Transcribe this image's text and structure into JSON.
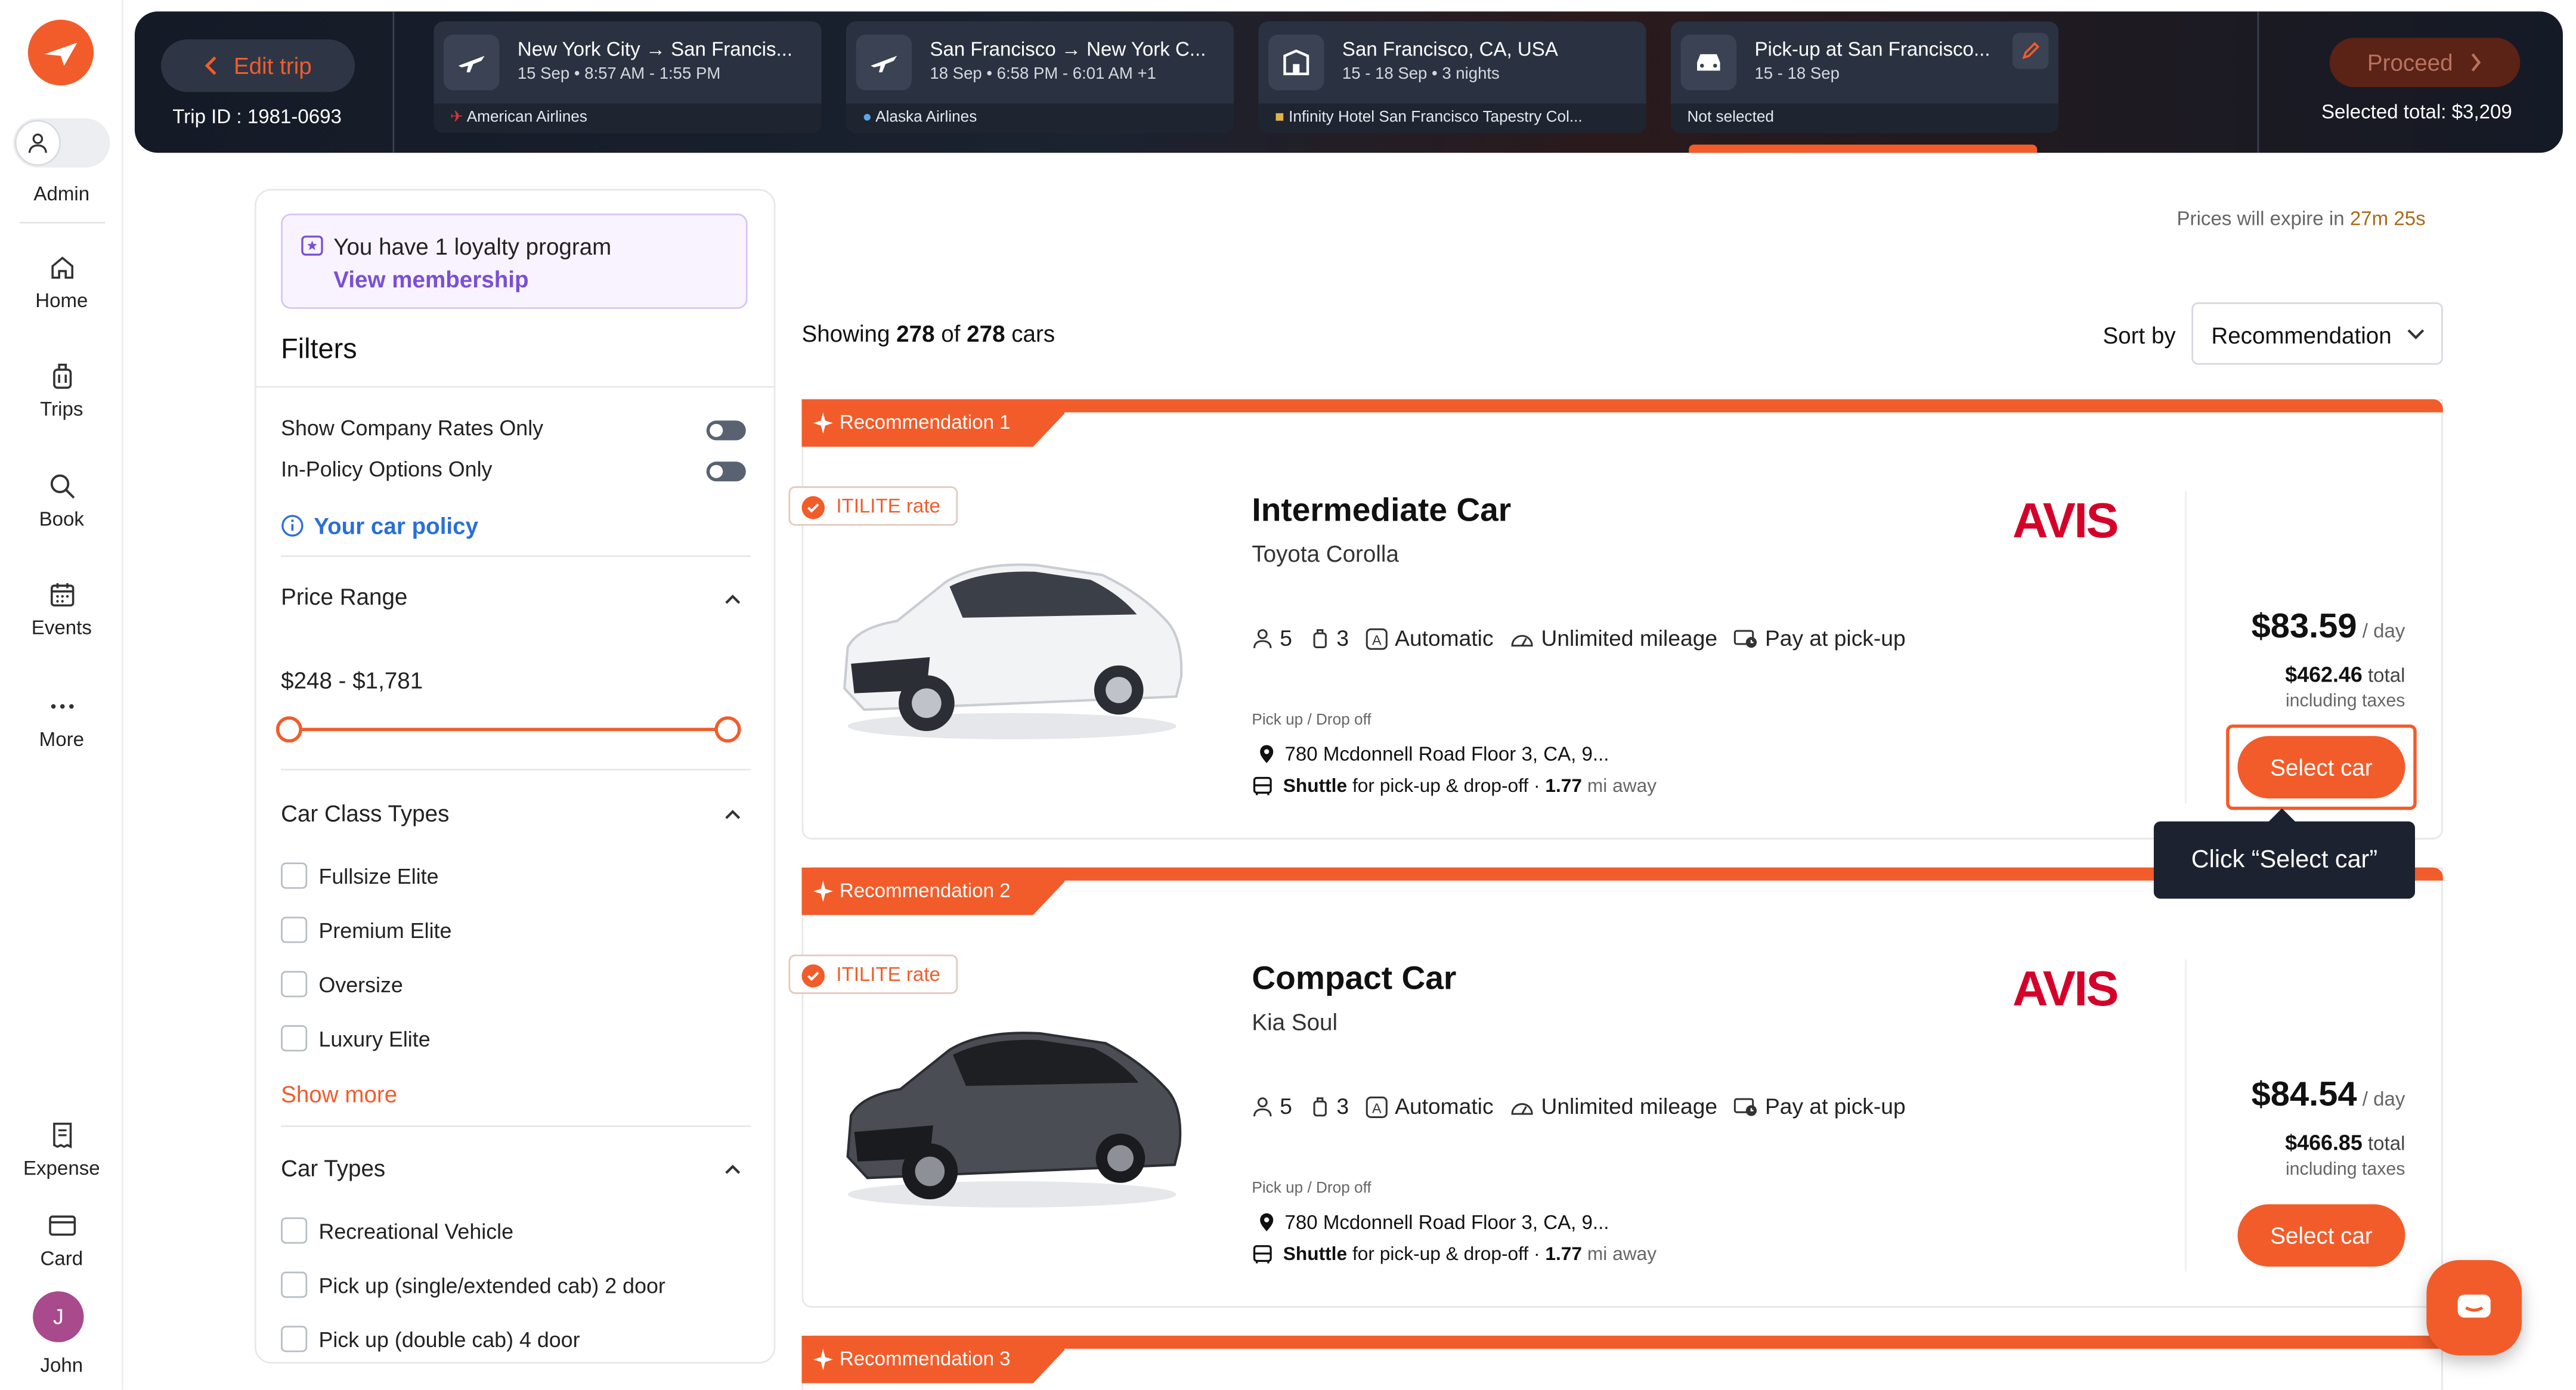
{
  "sidebar": {
    "role": "Admin",
    "items": [
      {
        "label": "Home",
        "icon": "home-icon"
      },
      {
        "label": "Trips",
        "icon": "luggage-icon"
      },
      {
        "label": "Book",
        "icon": "search-icon"
      },
      {
        "label": "Events",
        "icon": "calendar-icon"
      },
      {
        "label": "More",
        "icon": "more-icon"
      }
    ],
    "bottom": [
      {
        "label": "Expense",
        "icon": "receipt-icon"
      },
      {
        "label": "Card",
        "icon": "credit-card-icon"
      }
    ],
    "user": {
      "initial": "J",
      "name": "John"
    }
  },
  "topbar": {
    "edit_trip": "Edit trip",
    "trip_id_label": "Trip ID : ",
    "trip_id": "1981-0693",
    "segments": [
      {
        "title": "New York City → San Francis...",
        "sub": "15 Sep • 8:57 AM - 1:55 PM",
        "footer": "American Airlines",
        "icon": "plane-icon"
      },
      {
        "title": "San Francisco → New York C...",
        "sub": "18 Sep • 6:58 PM - 6:01 AM +1",
        "footer": "Alaska Airlines",
        "icon": "plane-icon"
      },
      {
        "title": "San Francisco, CA, USA",
        "sub": "15 - 18 Sep • 3 nights",
        "footer": "Infinity Hotel San Francisco Tapestry Col...",
        "icon": "hotel-icon"
      },
      {
        "title": "Pick-up at San Francisco...",
        "sub": "15 - 18 Sep",
        "footer": "Not selected",
        "icon": "car-icon"
      }
    ],
    "proceed": "Proceed",
    "selected_total": "Selected total: $3,209"
  },
  "filters": {
    "loyalty_text": "You have 1 loyalty program",
    "loyalty_link": "View membership",
    "title": "Filters",
    "company_rates": "Show Company Rates Only",
    "in_policy": "In-Policy Options Only",
    "car_policy": "Your car policy",
    "price_range_title": "Price Range",
    "price_range": "$248 - $1,781",
    "car_class_title": "Car Class Types",
    "car_classes": [
      "Fullsize Elite",
      "Premium Elite",
      "Oversize",
      "Luxury Elite"
    ],
    "show_more": "Show more",
    "car_types_title": "Car Types",
    "car_types": [
      "Recreational Vehicle",
      "Pick up (single/extended cab) 2 door",
      "Pick up (double cab) 4 door"
    ]
  },
  "main": {
    "expire_text": "Prices will expire in ",
    "expire_time": "27m 25s",
    "showing_prefix": "Showing ",
    "showing_count": "278",
    "showing_mid": " of ",
    "showing_total": "278",
    "showing_suffix": " cars",
    "sort_label": "Sort by",
    "sort_value": "Recommendation",
    "tooltip": "Click “Select car”",
    "cards": [
      {
        "tag": "Recommendation 1",
        "rate": "ITILITE rate",
        "name": "Intermediate Car",
        "model": "Toyota Corolla",
        "seats": "5",
        "bags": "3",
        "transmission": "Automatic",
        "mileage": "Unlimited mileage",
        "payment": "Pay at pick-up",
        "pickup_label": "Pick up / Drop off",
        "address": "780 Mcdonnell Road Floor 3, CA, 9...",
        "shuttle": "Shuttle",
        "shuttle_text": " for pick-up & drop-off · ",
        "distance": "1.77",
        "distance_unit": " mi away",
        "vendor": "AVIS",
        "price": "$83.59",
        "per_day": " / day",
        "total": "$462.46",
        "total_label": " total",
        "including": "including taxes",
        "select": "Select car",
        "car_color": "#f2f3f5"
      },
      {
        "tag": "Recommendation 2",
        "rate": "ITILITE rate",
        "name": "Compact Car",
        "model": "Kia Soul",
        "seats": "5",
        "bags": "3",
        "transmission": "Automatic",
        "mileage": "Unlimited mileage",
        "payment": "Pay at pick-up",
        "pickup_label": "Pick up / Drop off",
        "address": "780 Mcdonnell Road Floor 3, CA, 9...",
        "shuttle": "Shuttle",
        "shuttle_text": " for pick-up & drop-off · ",
        "distance": "1.77",
        "distance_unit": " mi away",
        "vendor": "AVIS",
        "price": "$84.54",
        "per_day": " / day",
        "total": "$466.85",
        "total_label": " total",
        "including": "including taxes",
        "select": "Select car",
        "car_color": "#4a4d53"
      },
      {
        "tag": "Recommendation 3"
      }
    ]
  },
  "colors": {
    "accent": "#f25c2a",
    "loyalty": "#7a4fd6",
    "vendor": "#d4002a",
    "topbar": "#141a26"
  }
}
